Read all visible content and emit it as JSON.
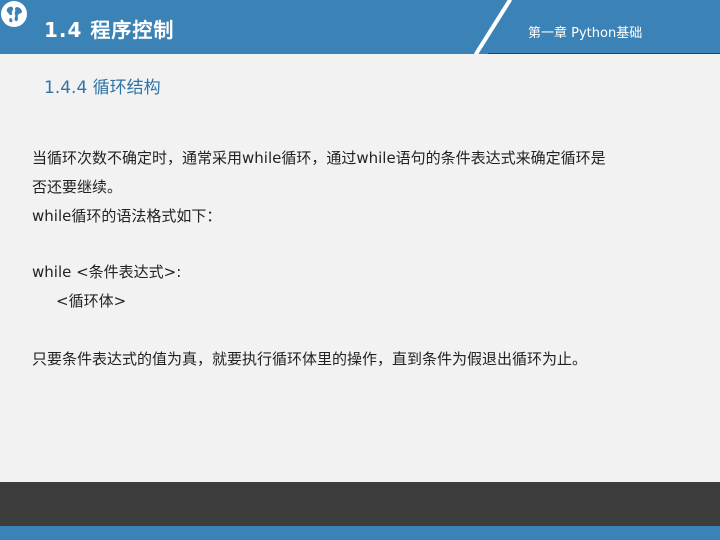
{
  "header": {
    "section_title": "1.4 程序控制",
    "chapter_title": "第一章 Python基础",
    "icon": "globe-icon",
    "colors": {
      "primary": "#3b82b6",
      "dark": "#3c3c3c",
      "heading": "#2e74a8"
    }
  },
  "subsection": {
    "title": "1.4.4 循环结构"
  },
  "content": {
    "paragraph1_line1": "当循环次数不确定时，通常采用while循环，通过while语句的条件表达式来确定循环是",
    "paragraph1_line2": "否还要继续。",
    "paragraph2": "while循环的语法格式如下：",
    "code_line1": "while <条件表达式>:",
    "code_line2": "<循环体>",
    "paragraph3": "只要条件表达式的值为真，就要执行循环体里的操作，直到条件为假退出循环为止。"
  }
}
